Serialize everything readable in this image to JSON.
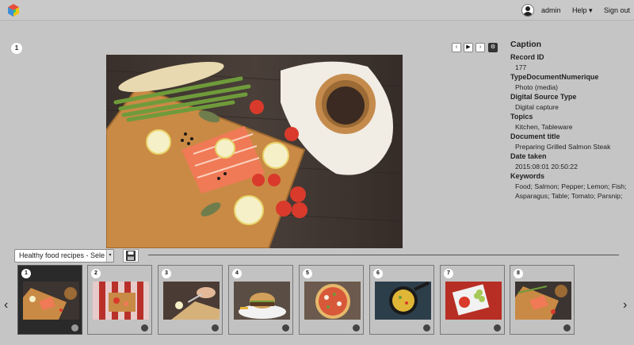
{
  "topbar": {
    "user_name": "admin",
    "help_label": "Help ▾",
    "signout_label": "Sign out"
  },
  "viewer": {
    "index": "1",
    "controls": {
      "prev": "‹",
      "play": "▶",
      "next": "›",
      "settings": "⚙"
    }
  },
  "caption": {
    "heading": "Caption",
    "fields": [
      {
        "label": "Record ID",
        "value": "177"
      },
      {
        "label": "TypeDocumentNumerique",
        "value": "Photo (media)"
      },
      {
        "label": "Digital Source Type",
        "value": "Digital capture"
      },
      {
        "label": "Topics",
        "value": "Kitchen, Tableware"
      },
      {
        "label": "Document title",
        "value": "Preparing Grilled Salmon Steak"
      },
      {
        "label": "Date taken",
        "value": "2015:08:01 20:50:22"
      },
      {
        "label": "Keywords",
        "value": "Food; Salmon; Pepper; Lemon; Fish; Asparagus; Table; Tomato; Parsnip;"
      }
    ]
  },
  "basket": {
    "selected": "Healthy food recipes - Sele",
    "arrow": "▾"
  },
  "strip": {
    "prev": "‹",
    "next": "›",
    "thumbs": [
      {
        "num": "1"
      },
      {
        "num": "2"
      },
      {
        "num": "3"
      },
      {
        "num": "4"
      },
      {
        "num": "5"
      },
      {
        "num": "6"
      },
      {
        "num": "7"
      },
      {
        "num": "8"
      }
    ]
  }
}
